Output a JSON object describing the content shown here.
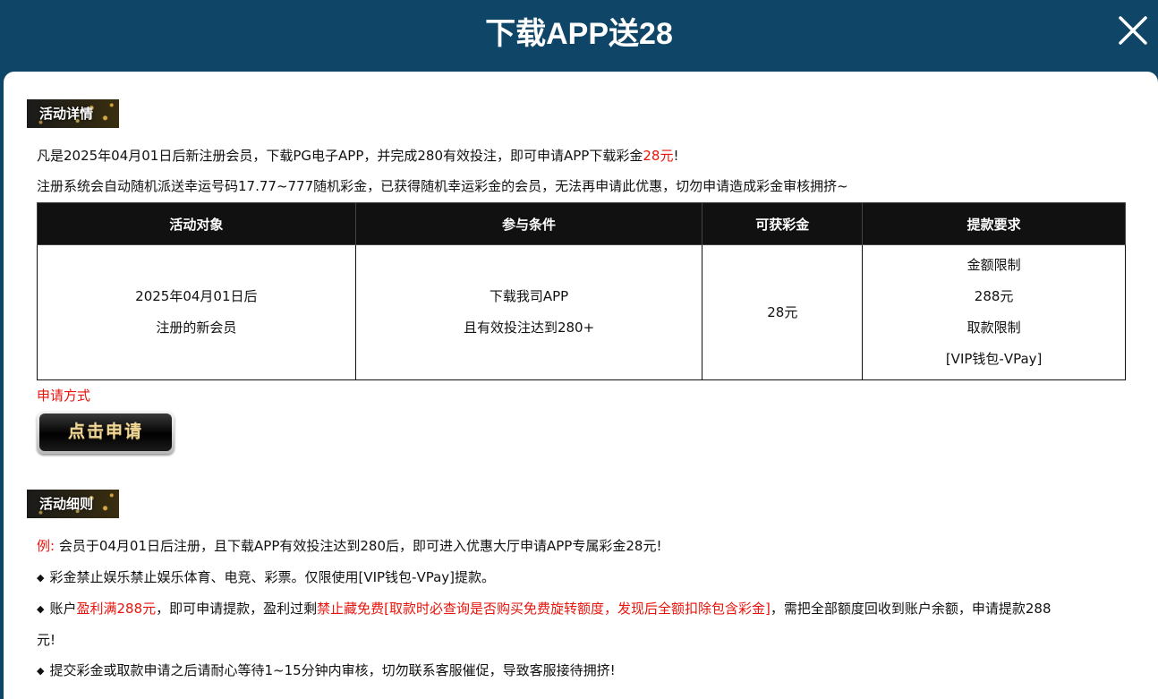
{
  "header": {
    "title": "下载APP送28",
    "close_icon": "close-icon"
  },
  "details_section": {
    "badge": "活动详情",
    "line1_prefix": "凡是2025年04月01日后新注册会员，下载PG电子APP，并完成280有效投注，即可申请APP下载彩金",
    "line1_amount": "28元",
    "line1_suffix": "!",
    "line2": "注册系统会自动随机派送幸运号码17.77~777随机彩金，已获得随机幸运彩金的会员，无法再申请此优惠，切勿申请造成彩金审核拥挤~"
  },
  "table": {
    "headers": [
      "活动对象",
      "参与条件",
      "可获彩金",
      "提款要求"
    ],
    "row": {
      "target": [
        "2025年04月01日后",
        "注册的新会员"
      ],
      "condition": [
        "下载我司APP",
        "且有效投注达到280+"
      ],
      "bonus": "28元",
      "withdraw": [
        "金额限制",
        "288元",
        "取款限制",
        "[VIP钱包-VPay]"
      ]
    }
  },
  "apply": {
    "label": "申请方式",
    "button_label": "点击申请"
  },
  "rules_section": {
    "badge": "活动细则",
    "example_label": "例:",
    "example_text": "会员于04月01日后注册，且下载APP有效投注达到280后，即可进入优惠大厅申请APP专属彩金28元!",
    "bullet_icon": "diamond-bullet-icon",
    "rule1": "彩金禁止娱乐禁止娱乐体育、电竞、彩票。仅限使用[VIP钱包-VPay]提款。",
    "rule2_a": "账户",
    "rule2_b": "盈利满288元",
    "rule2_c": "，即可申请提款，盈利过剩",
    "rule2_d": "禁止藏免费[取款时必查询是否购买免费旋转额度，发现后全额扣除包含彩金]",
    "rule2_e": "，需把全部额度回收到账户余额，申请提款288",
    "rule2_f": "元!",
    "rule3": "提交彩金或取款申请之后请耐心等待1~15分钟内审核，切勿联系客服催促，导致客服接待拥挤!"
  },
  "colors": {
    "header_bg": "#0f4566",
    "accent_red": "#e8140c",
    "table_header_bg": "#111111"
  }
}
